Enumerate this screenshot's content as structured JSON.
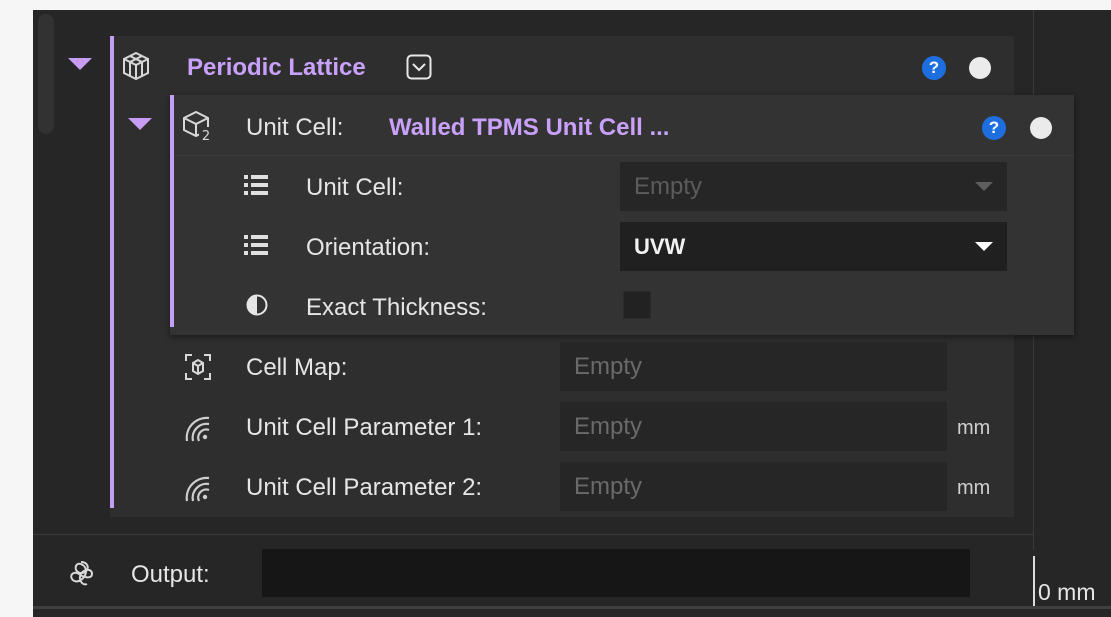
{
  "lattice": {
    "title": "Periodic Lattice",
    "help": "?",
    "icon": "lattice-cube-icon"
  },
  "unit_cell_header": {
    "label": "Unit Cell:",
    "value": "Walled TPMS Unit Cell ...",
    "help": "?",
    "icon": "unit-cell-icon"
  },
  "unit_cell_rows": [
    {
      "label": "Unit Cell:",
      "value": "Empty",
      "icon": "list-icon"
    },
    {
      "label": "Orientation:",
      "value": "UVW",
      "icon": "list-icon"
    },
    {
      "label": "Exact Thickness:",
      "checked": false,
      "icon": "half-circle-icon"
    }
  ],
  "lattice_rows": [
    {
      "label": "Cell Map:",
      "value": "Empty",
      "icon": "cell-map-icon"
    },
    {
      "label": "Unit Cell Parameter 1:",
      "value": "Empty",
      "unit": "mm",
      "icon": "signal-icon"
    },
    {
      "label": "Unit Cell Parameter 2:",
      "value": "Empty",
      "unit": "mm",
      "icon": "signal-icon"
    }
  ],
  "output": {
    "label": "Output:",
    "value": "",
    "icon": "output-knot-icon"
  },
  "side_value": "0 mm",
  "colors": {
    "accent": "#c9a1fb",
    "help_blue": "#1d6fe0",
    "panel": "#262626"
  }
}
